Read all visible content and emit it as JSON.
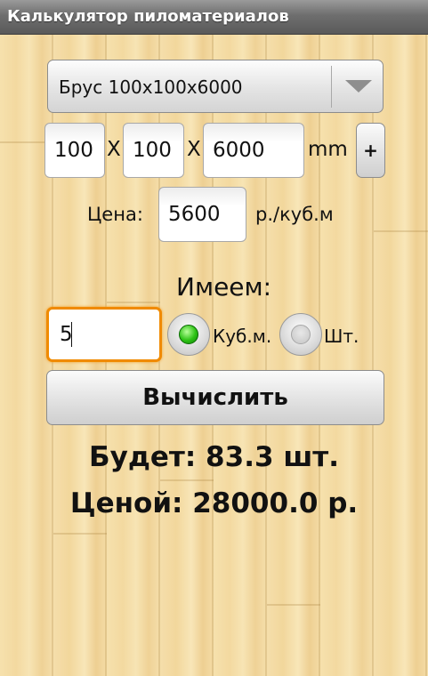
{
  "window": {
    "title": "Калькулятор пиломатериалов"
  },
  "lumber_select": {
    "selected": "Брус 100х100х6000"
  },
  "dimensions": {
    "width": "100",
    "height": "100",
    "length": "6000",
    "sep1": "X",
    "sep2": "X",
    "unit": "mm",
    "add_label": "+"
  },
  "price": {
    "label": "Цена:",
    "value": "5600",
    "unit": "р./куб.м"
  },
  "have": {
    "label": "Имеем:",
    "quantity": "5",
    "radio_cubic_label": "Куб.м.",
    "radio_pieces_label": "Шт.",
    "selected_radio": "cubic"
  },
  "actions": {
    "calculate_label": "Вычислить"
  },
  "result": {
    "will_be": "Будет: 83.3 шт.",
    "price_total": "Ценой: 28000.0 р."
  },
  "colors": {
    "focus_border": "#f08a00",
    "radio_selected": "#2cc214",
    "title_bar": "#6e6e6e"
  }
}
